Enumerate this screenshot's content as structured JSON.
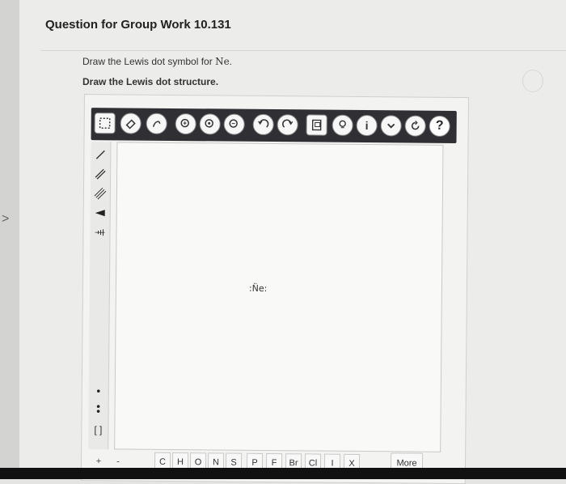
{
  "question": {
    "title": "Question for Group Work 10.131",
    "instruction_prefix": "Draw the Lewis dot symbol for ",
    "element": "Ne",
    "instruction_suffix": ".",
    "instruction2": "Draw the Lewis dot structure."
  },
  "toolbar": {
    "help_label": "?",
    "info_label": "i"
  },
  "canvas": {
    "ne_symbol": ":N̈e:"
  },
  "bottom_bar": {
    "plus": "+",
    "minus": "-",
    "elements": [
      "C",
      "H",
      "O",
      "N",
      "S",
      "P",
      "F",
      "Br",
      "Cl",
      "I",
      "X"
    ],
    "more_label": "More"
  },
  "left_tools": {
    "bracket": "[ ]"
  }
}
